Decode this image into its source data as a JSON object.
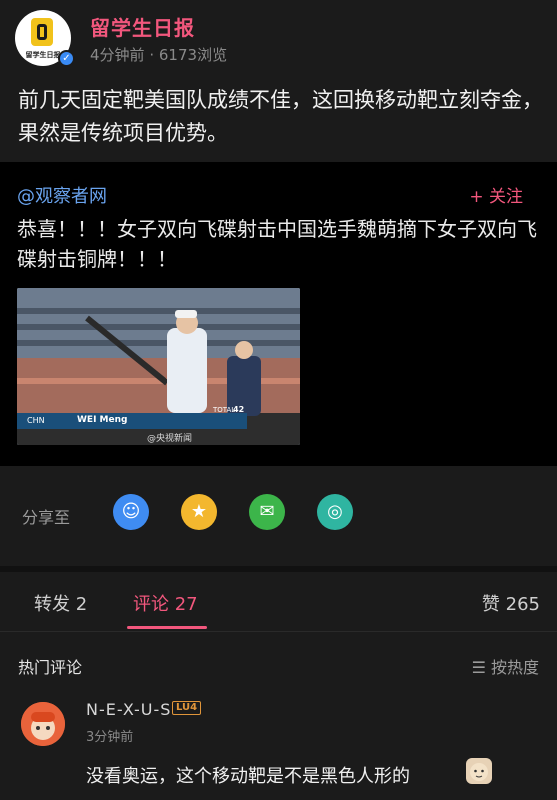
{
  "post": {
    "author": "留学生日报",
    "avatar_text": "留学生日报",
    "time": "4分钟前",
    "views": "6173浏览",
    "text": "前几天固定靶美国队成绩不佳，这回换移动靶立刻夺金，果然是传统项目优势。"
  },
  "repost": {
    "user": "@观察者网",
    "follow_label": "+ 关注",
    "text": "恭喜！！！女子双向飞碟射击中国选手魏萌摘下女子双向飞碟射击铜牌！！！",
    "video": {
      "athlete": "WEI Meng",
      "country": "CHN",
      "total_label": "TOTAL",
      "total": "42",
      "watermark": "@央视新闻"
    }
  },
  "share": {
    "label": "分享至",
    "icons": [
      {
        "name": "qq-icon",
        "color": "#3f8cf2"
      },
      {
        "name": "qzone-icon",
        "color": "#f3b72e"
      },
      {
        "name": "wechat-icon",
        "color": "#3cb54a"
      },
      {
        "name": "moments-icon",
        "color": "#2fb5a1"
      }
    ]
  },
  "tabs": {
    "repost": "转发 2",
    "comment": "评论 27",
    "like": "赞 265"
  },
  "comments": {
    "title": "热门评论",
    "sort_label": "☰ 按热度",
    "items": [
      {
        "name": "N-E-X-U-S",
        "level": "LU4",
        "time": "3分钟前",
        "text": "没看奥运，这个移动靶是不是黑色人形的"
      }
    ]
  }
}
